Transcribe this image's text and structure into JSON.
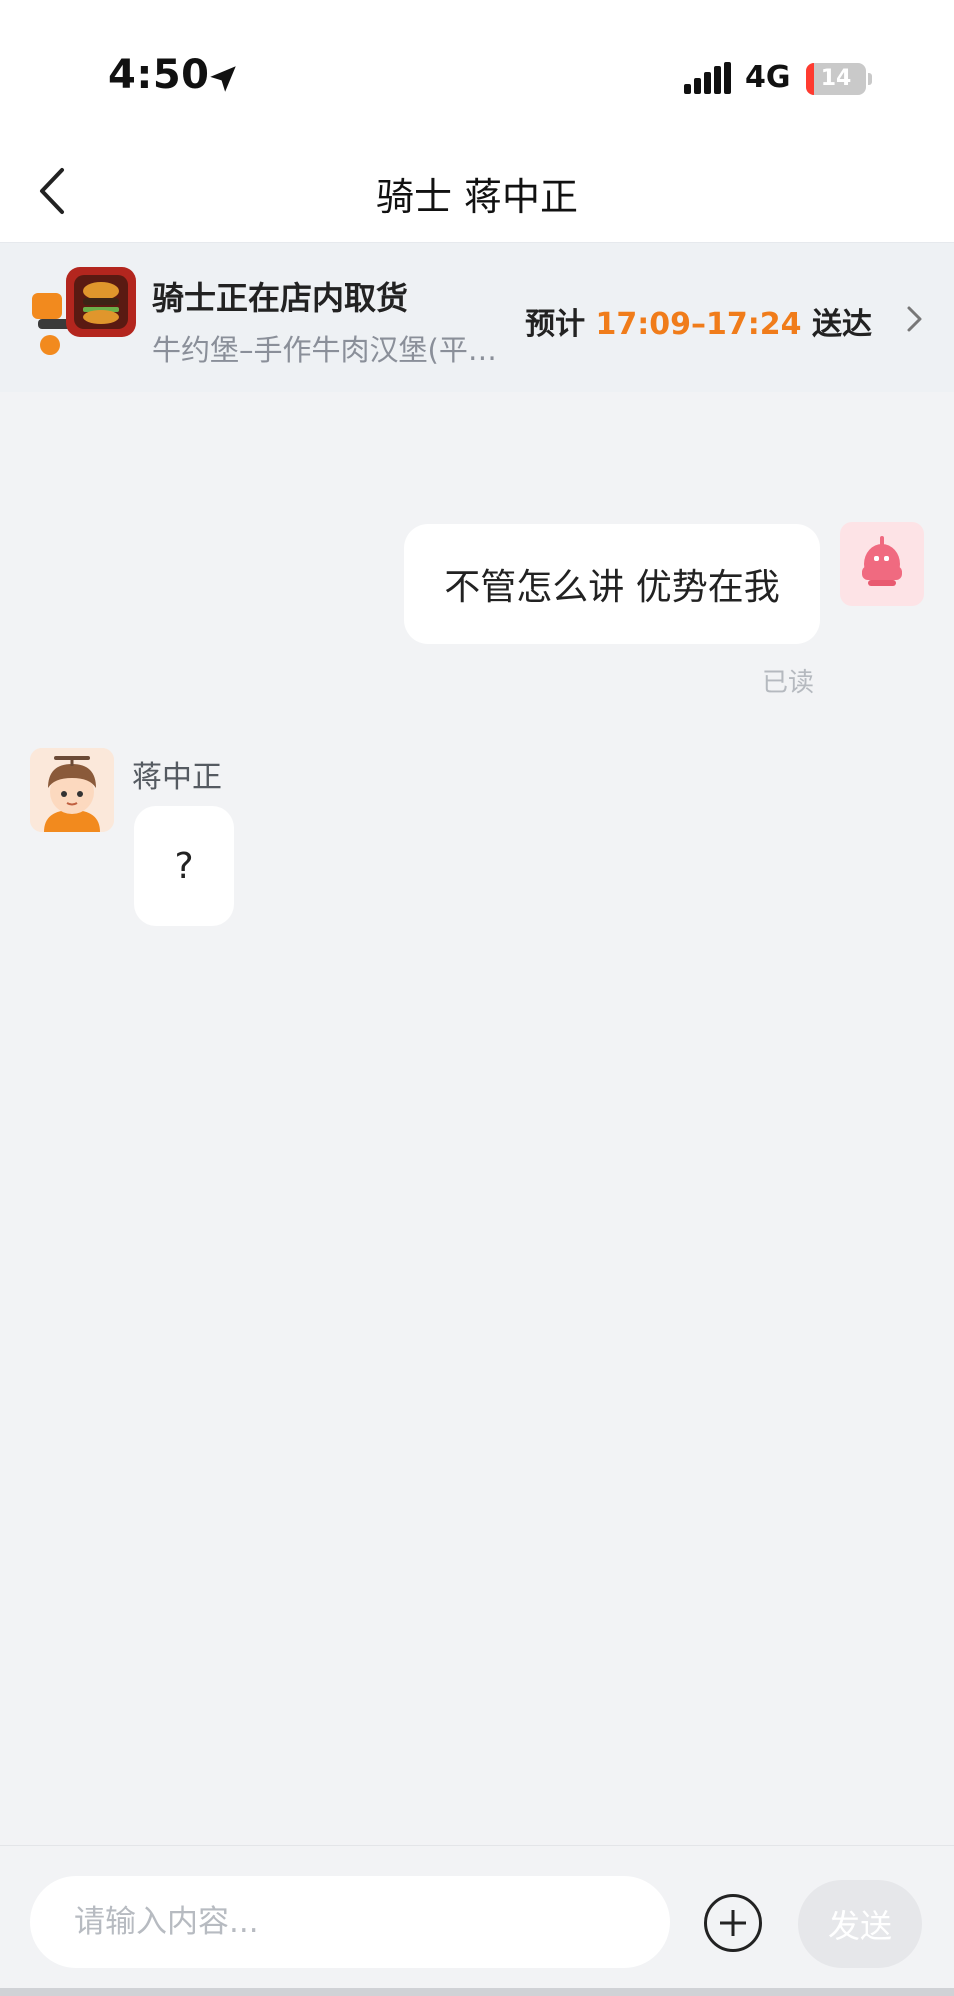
{
  "status_bar": {
    "time": "4:50",
    "network": "4G",
    "battery_level": "14",
    "battery_fraction": 0.14
  },
  "nav": {
    "title": "骑士 蒋中正"
  },
  "order": {
    "status": "骑士正在店内取货",
    "store": "牛约堡–手作牛肉汉堡(平…",
    "eta_prefix": "预计",
    "eta_range": "17:09–17:24",
    "eta_suffix": "送达"
  },
  "messages": {
    "outgoing_text": "不管怎么讲 优势在我",
    "read_status": "已读",
    "rider_name": "蒋中正",
    "incoming_text": "?"
  },
  "input": {
    "placeholder": "请输入内容...",
    "send_label": "发送"
  },
  "colors": {
    "accent_orange": "#f07c1a",
    "background": "#f2f3f5",
    "bubble": "#ffffff",
    "battery_low": "#ff3b30"
  },
  "icons": [
    "location-arrow-icon",
    "signal-icon",
    "battery-icon",
    "back-icon",
    "chevron-right-icon",
    "plus-icon"
  ]
}
